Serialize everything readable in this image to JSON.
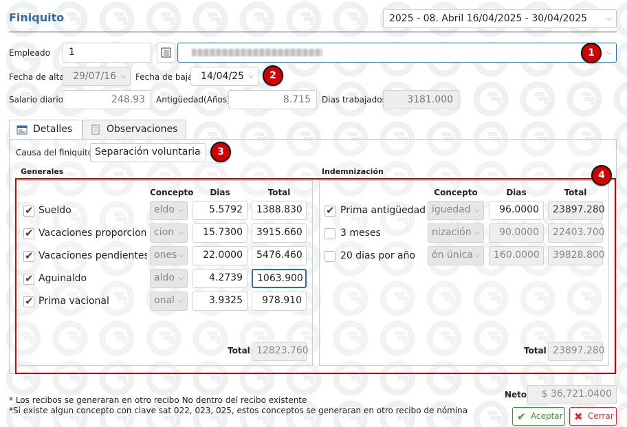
{
  "header": {
    "title": "Finiquito",
    "period": "2025 - 08. Abril 16/04/2025 - 30/04/2025"
  },
  "employee": {
    "label": "Empleado",
    "id": "1",
    "fecha_alta_label": "Fecha de alta",
    "fecha_alta": "29/07/16",
    "fecha_baja_label": "Fecha de baja",
    "fecha_baja": "14/04/25",
    "salario_label": "Salario diario",
    "salario": "248.93",
    "antiguedad_label": "Antigüedad(Años)",
    "antiguedad": "8.715",
    "dias_label": "Dias trabajados",
    "dias": "3181.000"
  },
  "tabs": [
    {
      "label": "Detalles"
    },
    {
      "label": "Observaciones"
    }
  ],
  "causa": {
    "label": "Causa del finiquito",
    "value": "Separación voluntaria"
  },
  "badges": [
    "1",
    "2",
    "3",
    "4"
  ],
  "generales": {
    "title": "Generales",
    "headers": {
      "concepto": "Concepto",
      "dias": "Dias",
      "total": "Total"
    },
    "rows": [
      {
        "label": "Sueldo",
        "concepto": "eldo",
        "dias": "5.5792",
        "total": "1388.830"
      },
      {
        "label": "Vacaciones proporcion",
        "concepto": "cion",
        "dias": "15.7300",
        "total": "3915.660"
      },
      {
        "label": "Vacaciones pendientes",
        "concepto": "ones",
        "dias": "22.0000",
        "total": "5476.460"
      },
      {
        "label": "Aguinaldo",
        "concepto": "aldo",
        "dias": "4.2739",
        "total": "1063.900"
      },
      {
        "label": "Prima vacional",
        "concepto": "onal",
        "dias": "3.9325",
        "total": "978.910"
      }
    ],
    "total_label": "Total",
    "total": "12823.760"
  },
  "indemnizacion": {
    "title": "Indemnización",
    "headers": {
      "concepto": "Concepto",
      "dias": "Dias",
      "total": "Total"
    },
    "rows": [
      {
        "label": "Prima antigüedad",
        "concepto": "iguedad",
        "dias": "96.0000",
        "total": "23897.280",
        "checked": true
      },
      {
        "label": "3 meses",
        "concepto": "nización",
        "dias": "90.0000",
        "total": "22403.700",
        "checked": false
      },
      {
        "label": "20 dias por año",
        "concepto": "ón única",
        "dias": "160.0000",
        "total": "39828.800",
        "checked": false
      }
    ],
    "total_label": "Total",
    "total": "23897.280"
  },
  "footer": {
    "notes": [
      "* Los recibos se generaran en otro recibo No dentro del recibo existente",
      "*Si existe algun concepto con clave sat 022, 023, 025, estos conceptos se generaran en otro recibo de nómina"
    ],
    "neto_label": "Neto",
    "neto": "$ 36,721.0400",
    "accept_label": "Aceptar",
    "cancel_label": "Cerrar"
  },
  "colors": {
    "accent": "#2f6c9f",
    "badge": "#d00000",
    "accept": "#2e9a2e",
    "cancel": "#d03030"
  }
}
